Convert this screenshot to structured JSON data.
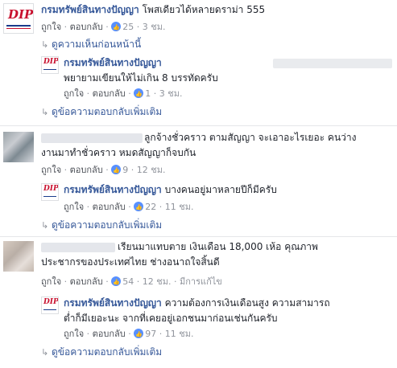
{
  "thread1": {
    "comment": {
      "author": "กรมทรัพย์สินทางปัญญา",
      "text": "โพสเดียวได้หลายดราม่า 555",
      "like": "ถูกใจ",
      "reply": "ตอบกลับ",
      "likes": "25",
      "time": "3 ชม."
    },
    "prev_label": "ดูความเห็นก่อนหน้านี้",
    "reply": {
      "author": "กรมทรัพย์สินทางปัญญา",
      "text": "พยายามเขียนให้ไม่เกิน 8 บรรทัดครับ",
      "like": "ถูกใจ",
      "reply": "ตอบกลับ",
      "likes": "1",
      "time": "3 ชม."
    },
    "more_label": "ดูข้อความตอบกลับเพิ่มเติม"
  },
  "thread2": {
    "comment": {
      "text_line1": "ลูกจ้างชั่วคราว ตามสัญญา จะเอาอะไรเยอะ คนว่าง",
      "text_line2": "งานมาทำชั่วคราว หมดสัญญาก็จบกัน",
      "like": "ถูกใจ",
      "reply": "ตอบกลับ",
      "likes": "9",
      "time": "12 ชม."
    },
    "reply": {
      "author": "กรมทรัพย์สินทางปัญญา",
      "text": "บางคนอยู่มาหลายปีก็มีครับ",
      "like": "ถูกใจ",
      "reply": "ตอบกลับ",
      "likes": "22",
      "time": "11 ชม."
    },
    "more_label": "ดูข้อความตอบกลับเพิ่มเติม"
  },
  "thread3": {
    "comment": {
      "text_line1": "เรียนมาแทบตาย เงินเดือน 18,000 เห้อ คุณภาพ",
      "text_line2": "ประชากรของประเทศไทย ช่างอนาถใจสิ้นดี",
      "like": "ถูกใจ",
      "reply": "ตอบกลับ",
      "likes": "54",
      "time": "12 ชม.",
      "edited": "มีการแก้ไข"
    },
    "reply": {
      "author": "กรมทรัพย์สินทางปัญญา",
      "text_line1": "ความต้องการเงินเดือนสูง ความสามารถ",
      "text_line2": "ต่ำก็มีเยอะนะ จากที่เคยอยู่เอกชนมาก่อนเช่นกันครับ",
      "like": "ถูกใจ",
      "reply": "ตอบกลับ",
      "likes": "97",
      "time": "11 ชม."
    },
    "more_label": "ดูข้อความตอบกลับเพิ่มเติม"
  },
  "logo_text": "DIP",
  "sep": "·"
}
